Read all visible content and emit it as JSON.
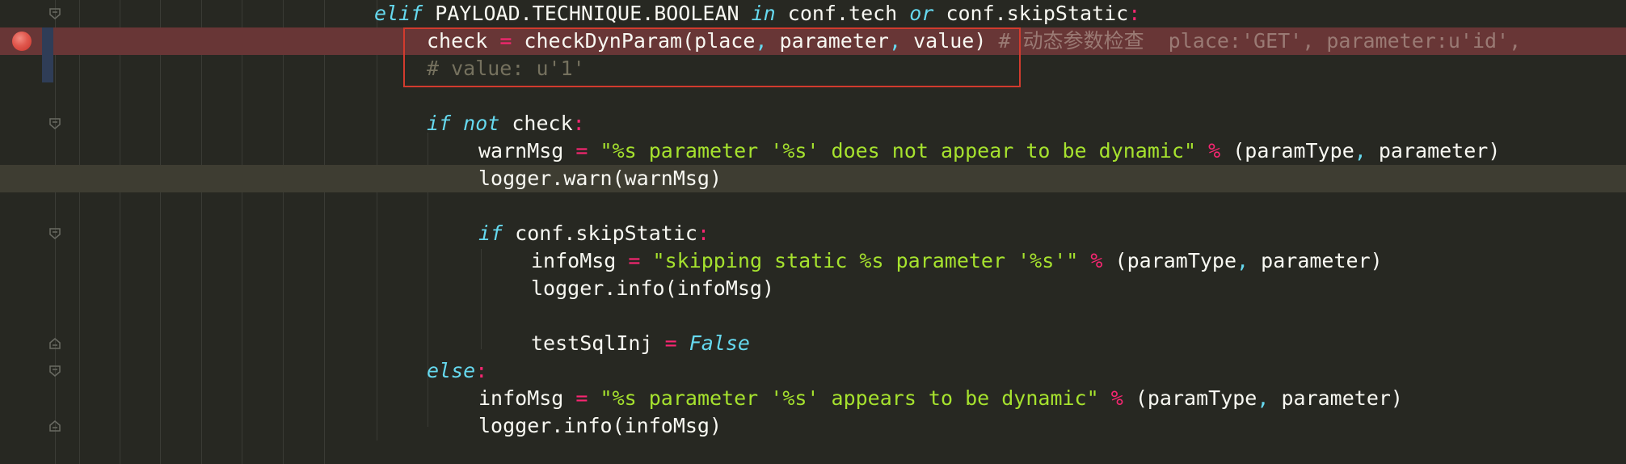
{
  "editor": {
    "lines": [
      {
        "id": "l1",
        "tokens": [
          {
            "t": "elif",
            "c": "kw"
          },
          {
            "t": " PAYLOAD.TECHNIQUE.BOOLEAN ",
            "c": ""
          },
          {
            "t": "in",
            "c": "kw"
          },
          {
            "t": " conf.tech ",
            "c": ""
          },
          {
            "t": "or",
            "c": "kw"
          },
          {
            "t": " conf.skipStatic",
            "c": ""
          },
          {
            "t": ":",
            "c": "op"
          }
        ]
      },
      {
        "id": "l2",
        "tokens": [
          {
            "t": "check ",
            "c": ""
          },
          {
            "t": "=",
            "c": "op"
          },
          {
            "t": " checkDynParam(place",
            "c": ""
          },
          {
            "t": ",",
            "c": "punc"
          },
          {
            "t": " parameter",
            "c": ""
          },
          {
            "t": ",",
            "c": "punc"
          },
          {
            "t": " value) ",
            "c": ""
          },
          {
            "t": "# 动态参数检查  place:'GET', parameter:u'id',",
            "c": "cmt-bp"
          }
        ]
      },
      {
        "id": "l3",
        "tokens": [
          {
            "t": "# value: u'1'",
            "c": "cmt"
          }
        ]
      },
      {
        "id": "l4",
        "tokens": []
      },
      {
        "id": "l5",
        "tokens": [
          {
            "t": "if",
            "c": "kw"
          },
          {
            "t": " ",
            "c": ""
          },
          {
            "t": "not",
            "c": "kw"
          },
          {
            "t": " check",
            "c": ""
          },
          {
            "t": ":",
            "c": "op"
          }
        ]
      },
      {
        "id": "l6",
        "tokens": [
          {
            "t": "warnMsg ",
            "c": ""
          },
          {
            "t": "=",
            "c": "op"
          },
          {
            "t": " ",
            "c": ""
          },
          {
            "t": "\"%s parameter '%s' does not appear to be dynamic\"",
            "c": "str"
          },
          {
            "t": " ",
            "c": ""
          },
          {
            "t": "%",
            "c": "op"
          },
          {
            "t": " (paramType",
            "c": ""
          },
          {
            "t": ",",
            "c": "punc"
          },
          {
            "t": " parameter)",
            "c": ""
          }
        ]
      },
      {
        "id": "l7",
        "tokens": [
          {
            "t": "logger.warn(warnMsg)",
            "c": ""
          }
        ]
      },
      {
        "id": "l8",
        "tokens": []
      },
      {
        "id": "l9",
        "tokens": [
          {
            "t": "if",
            "c": "kw"
          },
          {
            "t": " conf.skipStatic",
            "c": ""
          },
          {
            "t": ":",
            "c": "op"
          }
        ]
      },
      {
        "id": "l10",
        "tokens": [
          {
            "t": "infoMsg ",
            "c": ""
          },
          {
            "t": "=",
            "c": "op"
          },
          {
            "t": " ",
            "c": ""
          },
          {
            "t": "\"skipping static %s parameter '%s'\"",
            "c": "str"
          },
          {
            "t": " ",
            "c": ""
          },
          {
            "t": "%",
            "c": "op"
          },
          {
            "t": " (paramType",
            "c": ""
          },
          {
            "t": ",",
            "c": "punc"
          },
          {
            "t": " parameter)",
            "c": ""
          }
        ]
      },
      {
        "id": "l11",
        "tokens": [
          {
            "t": "logger.info(infoMsg)",
            "c": ""
          }
        ]
      },
      {
        "id": "l12",
        "tokens": []
      },
      {
        "id": "l13",
        "tokens": [
          {
            "t": "testSqlInj ",
            "c": ""
          },
          {
            "t": "=",
            "c": "op"
          },
          {
            "t": " ",
            "c": ""
          },
          {
            "t": "False",
            "c": "kw"
          }
        ]
      },
      {
        "id": "l14",
        "tokens": [
          {
            "t": "else",
            "c": "kw"
          },
          {
            "t": ":",
            "c": "op"
          }
        ]
      },
      {
        "id": "l15",
        "tokens": [
          {
            "t": "infoMsg ",
            "c": ""
          },
          {
            "t": "=",
            "c": "op"
          },
          {
            "t": " ",
            "c": ""
          },
          {
            "t": "\"%s parameter '%s' appears to be dynamic\"",
            "c": "str"
          },
          {
            "t": " ",
            "c": ""
          },
          {
            "t": "%",
            "c": "op"
          },
          {
            "t": " (paramType",
            "c": ""
          },
          {
            "t": ",",
            "c": "punc"
          },
          {
            "t": " parameter)",
            "c": ""
          }
        ]
      },
      {
        "id": "l16",
        "tokens": [
          {
            "t": "logger.info(infoMsg)",
            "c": ""
          }
        ]
      }
    ]
  },
  "colors": {
    "background": "#272822",
    "breakpoint_line": "#683636",
    "caret_line": "#3e3d32",
    "highlight_box": "#d23b2e",
    "keyword": "#66d9ef",
    "operator": "#f92672",
    "string": "#a6e22e",
    "comment": "#75715e"
  },
  "icons": {
    "breakpoint": "breakpoint-icon",
    "fold": "fold-marker-icon"
  }
}
